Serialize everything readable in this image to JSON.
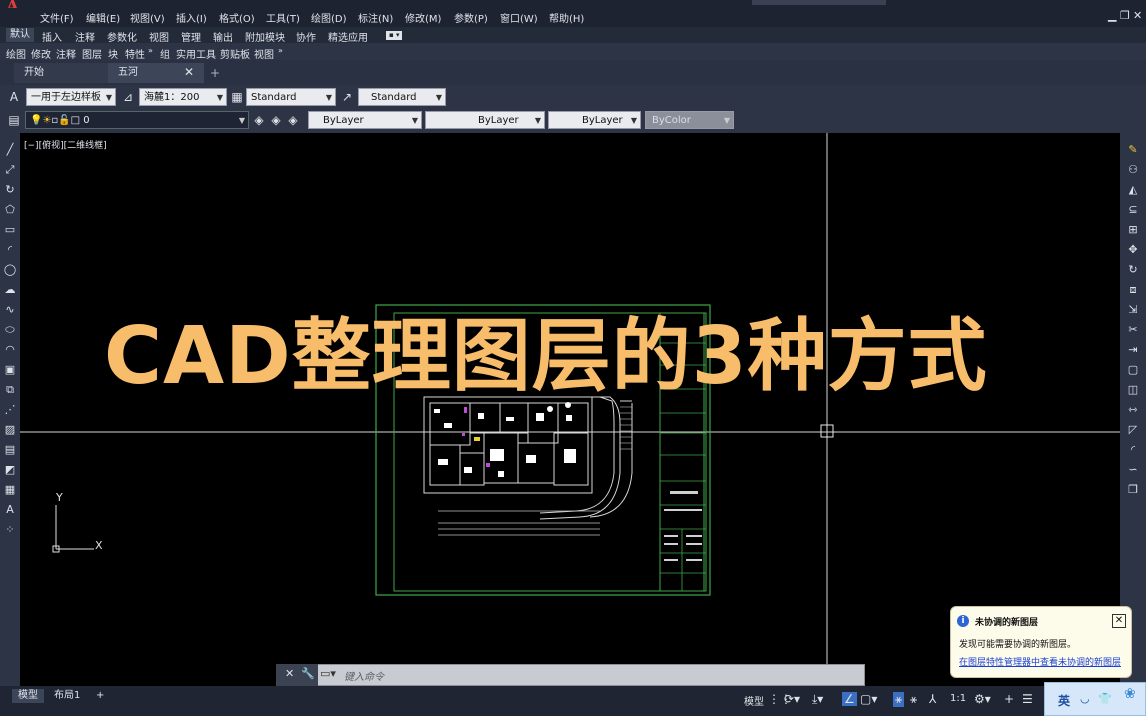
{
  "app": {
    "menus": [
      "文件(F)",
      "编辑(E)",
      "视图(V)",
      "插入(I)",
      "格式(O)",
      "工具(T)",
      "绘图(D)",
      "标注(N)",
      "修改(M)",
      "参数(P)",
      "窗口(W)",
      "帮助(H)"
    ],
    "ribbon_tabs": [
      "默认",
      "插入",
      "注释",
      "参数化",
      "视图",
      "管理",
      "输出",
      "附加模块",
      "协作",
      "精选应用"
    ],
    "panels": [
      "绘图",
      "修改",
      "注释",
      "图层",
      "块",
      "特性",
      "组",
      "实用工具",
      "剪贴板",
      "视图"
    ]
  },
  "doc_tabs": {
    "start": "开始",
    "current": "五河"
  },
  "toolbar1": {
    "text_style": "一用于左边样板",
    "dim_scale": "海麓1：200",
    "table_style": "Standard",
    "multileader_style": "Standard"
  },
  "toolbar2": {
    "layer": "0",
    "color": "ByLayer",
    "linetype": "ByLayer",
    "lineweight": "ByLayer",
    "plot_style": "ByColor"
  },
  "viewport_label": "[−][俯视][二维线框]",
  "ucs": {
    "x_label": "X",
    "y_label": "Y"
  },
  "overlay_title": "CAD整理图层的3种方式",
  "notification": {
    "title": "未协调的新图层",
    "body": "发现可能需要协调的新图层。",
    "link": "在图层特性管理器中查看未协调的新图层"
  },
  "command_line": {
    "placeholder": "键入命令"
  },
  "status_bar": {
    "layout_tabs": [
      "模型",
      "布局1"
    ],
    "model_label": "模型",
    "scale": "1:1",
    "ime": "英"
  },
  "colors": {
    "title_orange": "#f8bd6a",
    "drawing_bg": "#000000",
    "toolbar_bg": "#2c3445",
    "plan_green": "#3fa84a",
    "accent_blue": "#3a6fc4"
  },
  "icons": [
    "autocad-logo-icon",
    "close-icon",
    "plus-icon",
    "line-icon",
    "circle-icon",
    "move-icon",
    "gear-icon",
    "info-icon",
    "wrench-icon"
  ]
}
